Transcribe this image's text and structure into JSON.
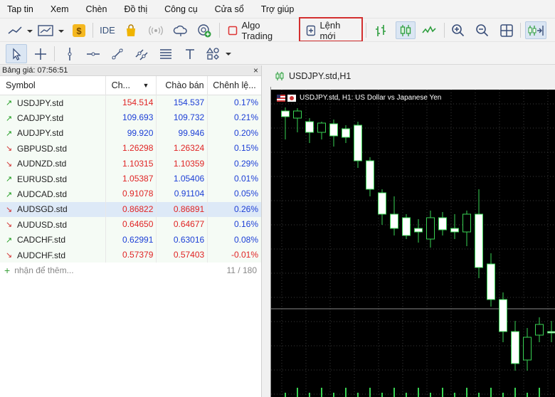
{
  "menu": [
    "Tap tin",
    "Xem",
    "Chèn",
    "Đồ thị",
    "Công cụ",
    "Cửa sổ",
    "Trợ giúp"
  ],
  "toolbar": {
    "ide_label": "IDE",
    "algo_label": "Algo Trading",
    "new_order_label": "Lệnh mới"
  },
  "market_watch": {
    "title": "Bảng giá: 07:56:51",
    "close": "×",
    "columns": {
      "symbol": "Symbol",
      "bid": "Ch...",
      "ask": "Chào bán",
      "spread": "Chênh lệ..."
    },
    "rows": [
      {
        "dir": "up",
        "symbol": "USDJPY.std",
        "bid": "154.514",
        "ask": "154.537",
        "spread": "0.17%",
        "bid_color": "red",
        "ask_color": "blue",
        "spread_color": "blue"
      },
      {
        "dir": "up",
        "symbol": "CADJPY.std",
        "bid": "109.693",
        "ask": "109.732",
        "spread": "0.21%",
        "bid_color": "blue",
        "ask_color": "blue",
        "spread_color": "blue"
      },
      {
        "dir": "up",
        "symbol": "AUDJPY.std",
        "bid": "99.920",
        "ask": "99.946",
        "spread": "0.20%",
        "bid_color": "blue",
        "ask_color": "blue",
        "spread_color": "blue"
      },
      {
        "dir": "down",
        "symbol": "GBPUSD.std",
        "bid": "1.26298",
        "ask": "1.26324",
        "spread": "0.15%",
        "bid_color": "red",
        "ask_color": "red",
        "spread_color": "blue"
      },
      {
        "dir": "down",
        "symbol": "AUDNZD.std",
        "bid": "1.10315",
        "ask": "1.10359",
        "spread": "0.29%",
        "bid_color": "red",
        "ask_color": "red",
        "spread_color": "blue"
      },
      {
        "dir": "up",
        "symbol": "EURUSD.std",
        "bid": "1.05387",
        "ask": "1.05406",
        "spread": "0.01%",
        "bid_color": "red",
        "ask_color": "blue",
        "spread_color": "blue"
      },
      {
        "dir": "up",
        "symbol": "AUDCAD.std",
        "bid": "0.91078",
        "ask": "0.91104",
        "spread": "0.05%",
        "bid_color": "red",
        "ask_color": "blue",
        "spread_color": "blue"
      },
      {
        "dir": "down",
        "symbol": "AUDSGD.std",
        "bid": "0.86822",
        "ask": "0.86891",
        "spread": "0.26%",
        "bid_color": "red",
        "ask_color": "red",
        "spread_color": "blue"
      },
      {
        "dir": "down",
        "symbol": "AUDUSD.std",
        "bid": "0.64650",
        "ask": "0.64677",
        "spread": "0.16%",
        "bid_color": "red",
        "ask_color": "red",
        "spread_color": "blue"
      },
      {
        "dir": "up",
        "symbol": "CADCHF.std",
        "bid": "0.62991",
        "ask": "0.63016",
        "spread": "0.08%",
        "bid_color": "blue",
        "ask_color": "blue",
        "spread_color": "blue"
      },
      {
        "dir": "down",
        "symbol": "AUDCHF.std",
        "bid": "0.57379",
        "ask": "0.57403",
        "spread": "-0.01%",
        "bid_color": "red",
        "ask_color": "red",
        "spread_color": "red"
      }
    ],
    "add_label": "nhận để thêm...",
    "count": "11 / 180"
  },
  "chart": {
    "tab_title": "USDJPY.std,H1",
    "caption": "USDJPY.std, H1:  US Dollar vs Japanese Yen"
  }
}
